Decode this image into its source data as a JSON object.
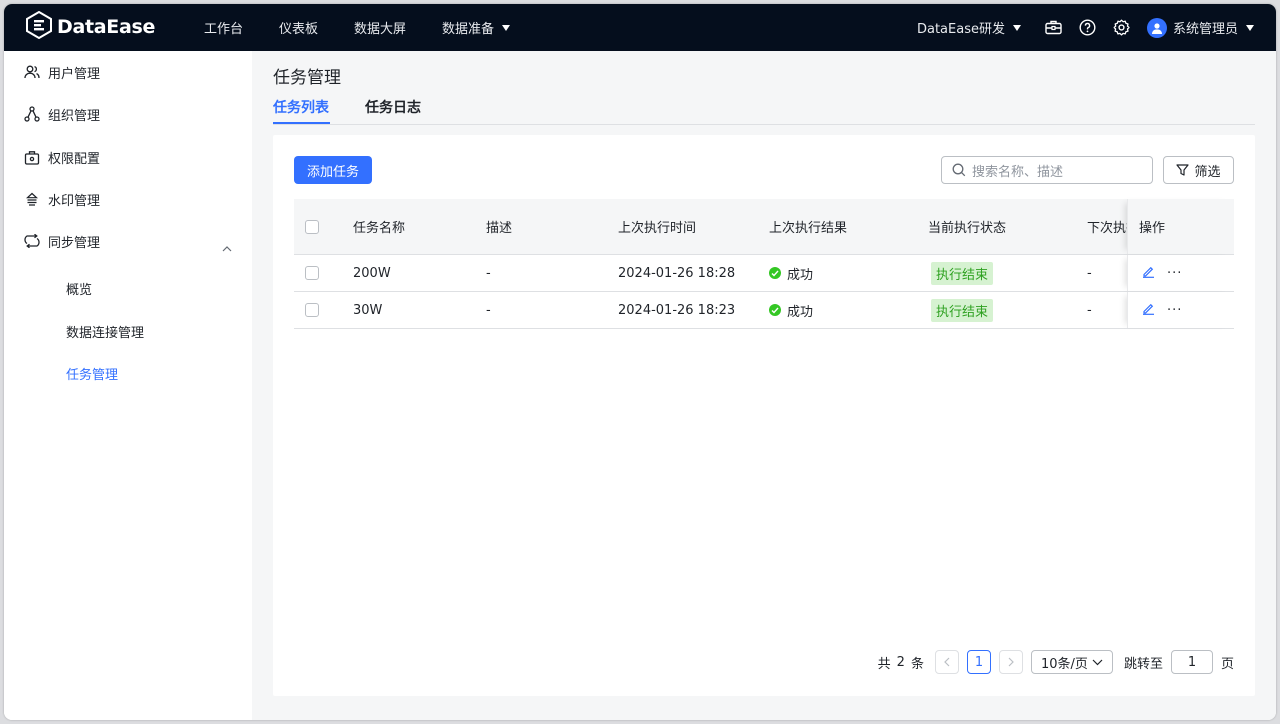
{
  "topbar": {
    "logo_text": "DataEase",
    "nav": [
      "工作台",
      "仪表板",
      "数据大屏",
      "数据准备"
    ],
    "org": "DataEase研发",
    "user": "系统管理员"
  },
  "sidebar": {
    "items": [
      {
        "label": "用户管理",
        "icon": "users-icon"
      },
      {
        "label": "组织管理",
        "icon": "org-tree-icon"
      },
      {
        "label": "权限配置",
        "icon": "lock-box-icon"
      },
      {
        "label": "水印管理",
        "icon": "watermark-icon"
      },
      {
        "label": "同步管理",
        "icon": "sync-icon"
      }
    ],
    "sub_items": [
      {
        "label": "概览",
        "active": false
      },
      {
        "label": "数据连接管理",
        "active": false
      },
      {
        "label": "任务管理",
        "active": true
      }
    ]
  },
  "main": {
    "title": "任务管理",
    "tabs": [
      {
        "label": "任务列表",
        "active": true
      },
      {
        "label": "任务日志",
        "active": false
      }
    ],
    "add_button": "添加任务",
    "search_placeholder": "搜索名称、描述",
    "filter_button": "筛选",
    "table": {
      "columns": [
        "任务名称",
        "描述",
        "上次执行时间",
        "上次执行结果",
        "当前执行状态",
        "下次执行",
        "操作"
      ],
      "rows": [
        {
          "name": "200W",
          "desc": "-",
          "last_time": "2024-01-26  18:28",
          "last_result": "成功",
          "status": "执行结束",
          "next": "-"
        },
        {
          "name": "30W",
          "desc": "-",
          "last_time": "2024-01-26  18:23",
          "last_result": "成功",
          "status": "执行结束",
          "next": "-"
        }
      ]
    },
    "pagination": {
      "total_prefix": "共",
      "total": "2",
      "total_suffix": "条",
      "current_page": "1",
      "page_size": "10条/页",
      "jump_label": "跳转至",
      "jump_value": "1",
      "page_unit": "页"
    }
  },
  "colors": {
    "primary": "#3370ff",
    "topbar": "#050e1d",
    "success": "#34c724",
    "tag_bg": "#d6f2d1"
  }
}
